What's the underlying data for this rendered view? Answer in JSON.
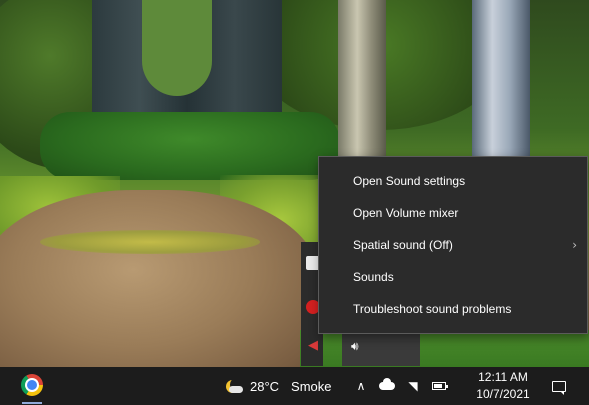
{
  "context_menu": {
    "items": [
      {
        "label": "Open Sound settings",
        "has_submenu": false
      },
      {
        "label": "Open Volume mixer",
        "has_submenu": false
      },
      {
        "label": "Spatial sound (Off)",
        "has_submenu": true
      },
      {
        "label": "Sounds",
        "has_submenu": false
      },
      {
        "label": "Troubleshoot sound problems",
        "has_submenu": false
      }
    ],
    "submenu_glyph": "›"
  },
  "tray_popup": {
    "icons": [
      "app-icon",
      "red-app-icon",
      "speaker-icon"
    ],
    "speaker_glyph": "◀"
  },
  "volume": {
    "icon": "speaker-volume-icon",
    "glyph": "🔊︎"
  },
  "taskbar": {
    "pinned": [
      {
        "name": "Google Chrome",
        "icon": "chrome-icon"
      }
    ],
    "weather": {
      "temp": "28°C",
      "condition": "Smoke",
      "icon": "moon-cloud-icon"
    },
    "tray": {
      "chevron": "∧",
      "icons": [
        "show-hidden-icons-chevron",
        "onedrive-cloud-icon",
        "wifi-icon",
        "battery-icon"
      ],
      "wifi_glyph": "◥"
    },
    "clock": {
      "time": "12:11 AM",
      "date": "10/7/2021"
    },
    "notification_icon": "action-center-icon"
  },
  "colors": {
    "menu_bg": "#2b2b2b",
    "menu_border": "#5b5b5b",
    "taskbar_bg": "#1c1c1c",
    "text": "#ffffff"
  }
}
